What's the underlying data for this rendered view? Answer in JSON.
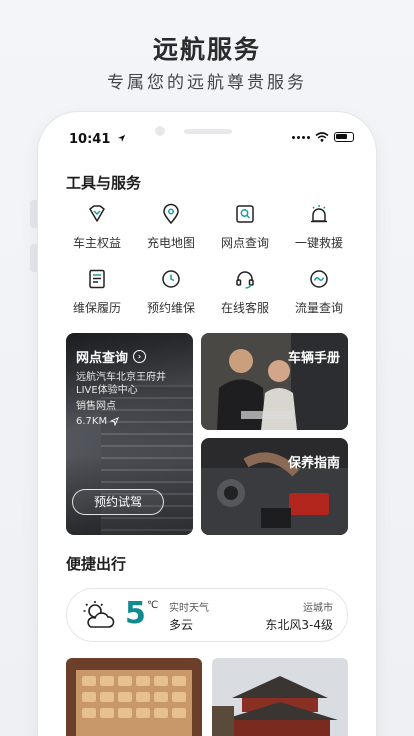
{
  "hero": {
    "title": "远航服务",
    "subtitle": "专属您的远航尊贵服务"
  },
  "status_bar": {
    "time": "10:41",
    "icons": [
      "location-arrow-icon",
      "signal-dots-icon",
      "wifi-icon",
      "battery-icon"
    ]
  },
  "tools_section": {
    "title": "工具与服务",
    "items": [
      {
        "label": "车主权益",
        "icon": "owner-rights-icon"
      },
      {
        "label": "充电地图",
        "icon": "charging-map-pin-icon"
      },
      {
        "label": "网点查询",
        "icon": "outlet-search-icon"
      },
      {
        "label": "一键救援",
        "icon": "rescue-siren-icon"
      },
      {
        "label": "维保履历",
        "icon": "maintenance-record-icon"
      },
      {
        "label": "预约维保",
        "icon": "clock-icon"
      },
      {
        "label": "在线客服",
        "icon": "headset-icon"
      },
      {
        "label": "流量查询",
        "icon": "data-wave-icon"
      }
    ]
  },
  "cards": {
    "outlet": {
      "title": "网点查询",
      "line1": "远航汽车北京王府井",
      "line2": "LIVE体验中心",
      "line3": "销售网点",
      "distance": "6.7KM",
      "button": "预约试驾"
    },
    "manual": {
      "title": "车辆手册"
    },
    "maintenance": {
      "title": "保养指南"
    }
  },
  "travel_section": {
    "title": "便捷出行",
    "weather": {
      "temperature": "5",
      "unit": "℃",
      "label": "实时天气",
      "condition": "多云",
      "city": "运城市",
      "wind": "东北风3-4级",
      "icon": "partly-cloudy-icon"
    }
  },
  "colors": {
    "accent_teal": "#0f8a8e",
    "background": "#f1f3f6"
  }
}
